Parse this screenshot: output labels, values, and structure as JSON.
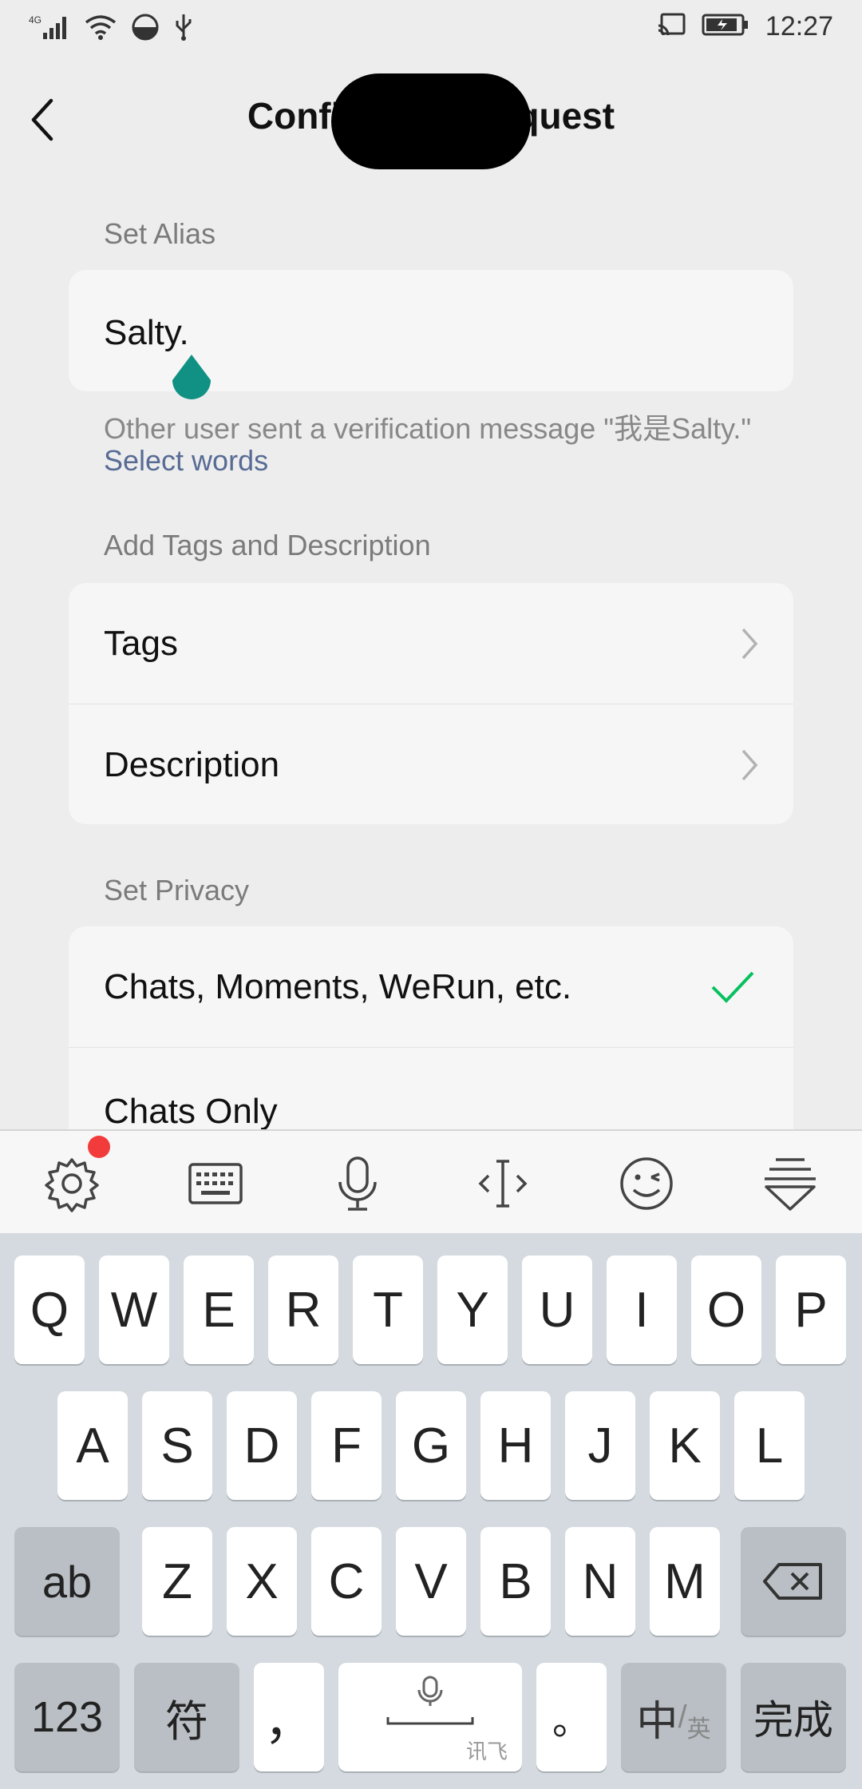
{
  "status": {
    "network": "4G",
    "time": "12:27"
  },
  "header": {
    "title_left": "Confi",
    "title_right": "quest"
  },
  "alias": {
    "section_label": "Set Alias",
    "value": "Salty.",
    "verification_message": "Other user sent a verification message \"我是Salty.\"",
    "select_words": "Select words"
  },
  "tags_section": {
    "section_label": "Add Tags and Description",
    "rows": [
      {
        "label": "Tags"
      },
      {
        "label": "Description"
      }
    ]
  },
  "privacy": {
    "section_label": "Set Privacy",
    "options": [
      {
        "label": "Chats, Moments, WeRun, etc.",
        "selected": true
      },
      {
        "label": "Chats Only",
        "selected": false
      }
    ]
  },
  "keyboard": {
    "row1": [
      "Q",
      "W",
      "E",
      "R",
      "T",
      "Y",
      "U",
      "I",
      "O",
      "P"
    ],
    "row2": [
      "A",
      "S",
      "D",
      "F",
      "G",
      "H",
      "J",
      "K",
      "L"
    ],
    "row3": [
      "Z",
      "X",
      "C",
      "V",
      "B",
      "N",
      "M"
    ],
    "shift_label": "ab",
    "num_label": "123",
    "symbol_label": "符",
    "comma_label": "，",
    "space_sub_label": "讯飞",
    "period_label": "。",
    "lang_main": "中",
    "lang_sub": "英",
    "done_label": "完成"
  },
  "colors": {
    "accent_green": "#07c160",
    "link_blue": "#576b95",
    "cursor_teal": "#119183",
    "notify_red": "#f23b3b"
  }
}
